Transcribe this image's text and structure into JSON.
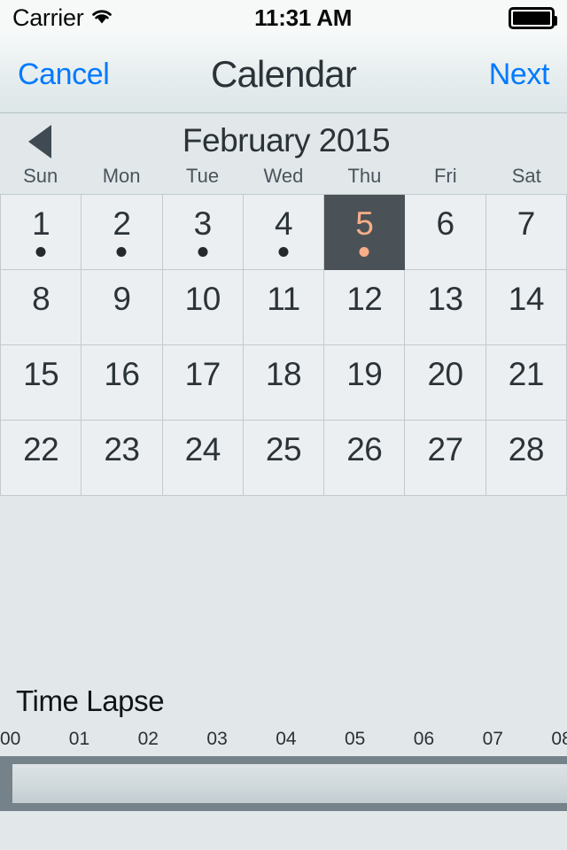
{
  "status_bar": {
    "carrier": "Carrier",
    "wifi_icon": "wifi-icon",
    "time": "11:31 AM",
    "battery_icon": "battery-full-icon"
  },
  "nav_bar": {
    "cancel_label": "Cancel",
    "title": "Calendar",
    "next_label": "Next"
  },
  "calendar": {
    "prev_icon": "triangle-left-icon",
    "month_label": "February 2015",
    "weekdays": [
      "Sun",
      "Mon",
      "Tue",
      "Wed",
      "Thu",
      "Fri",
      "Sat"
    ],
    "selected_day": 5,
    "selected_color": "#f9ad88",
    "selected_bg": "#4a5257",
    "dot_color": "#25292c",
    "weeks": [
      [
        {
          "day": "1",
          "dot": true,
          "selected": false
        },
        {
          "day": "2",
          "dot": true,
          "selected": false
        },
        {
          "day": "3",
          "dot": true,
          "selected": false
        },
        {
          "day": "4",
          "dot": true,
          "selected": false
        },
        {
          "day": "5",
          "dot": true,
          "selected": true
        },
        {
          "day": "6",
          "dot": false,
          "selected": false
        },
        {
          "day": "7",
          "dot": false,
          "selected": false
        }
      ],
      [
        {
          "day": "8",
          "dot": false,
          "selected": false
        },
        {
          "day": "9",
          "dot": false,
          "selected": false
        },
        {
          "day": "10",
          "dot": false,
          "selected": false
        },
        {
          "day": "11",
          "dot": false,
          "selected": false
        },
        {
          "day": "12",
          "dot": false,
          "selected": false
        },
        {
          "day": "13",
          "dot": false,
          "selected": false
        },
        {
          "day": "14",
          "dot": false,
          "selected": false
        }
      ],
      [
        {
          "day": "15",
          "dot": false,
          "selected": false
        },
        {
          "day": "16",
          "dot": false,
          "selected": false
        },
        {
          "day": "17",
          "dot": false,
          "selected": false
        },
        {
          "day": "18",
          "dot": false,
          "selected": false
        },
        {
          "day": "19",
          "dot": false,
          "selected": false
        },
        {
          "day": "20",
          "dot": false,
          "selected": false
        },
        {
          "day": "21",
          "dot": false,
          "selected": false
        }
      ],
      [
        {
          "day": "22",
          "dot": false,
          "selected": false
        },
        {
          "day": "23",
          "dot": false,
          "selected": false
        },
        {
          "day": "24",
          "dot": false,
          "selected": false
        },
        {
          "day": "25",
          "dot": false,
          "selected": false
        },
        {
          "day": "26",
          "dot": false,
          "selected": false
        },
        {
          "day": "27",
          "dot": false,
          "selected": false
        },
        {
          "day": "28",
          "dot": false,
          "selected": false
        }
      ]
    ]
  },
  "time_lapse": {
    "title": "Time Lapse",
    "hour_ticks": [
      "00",
      "01",
      "02",
      "03",
      "04",
      "05",
      "06",
      "07",
      "08"
    ],
    "track_color": "#76828a"
  },
  "theme": {
    "accent_blue": "#007aff",
    "page_bg": "#e2e8ea",
    "cell_bg": "#eceff1",
    "border": "#c2cacd",
    "text_dark": "#2b3338"
  }
}
